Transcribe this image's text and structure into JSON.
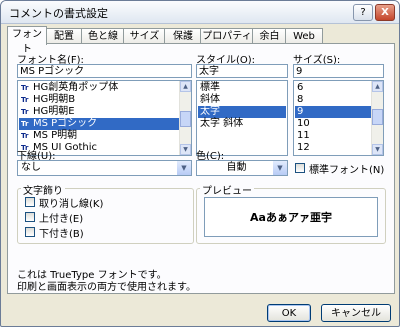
{
  "window": {
    "title": "コメントの書式設定",
    "help": "?",
    "close": "X"
  },
  "tabs": [
    "フォント",
    "配置",
    "色と線",
    "サイズ",
    "保護",
    "プロパティ",
    "余白",
    "Web"
  ],
  "font": {
    "label": "フォント名(F):",
    "value": "MS Pゴシック",
    "items": [
      "HG創英角ポップ体",
      "HG明朝B",
      "HG明朝E",
      "MS Pゴシック",
      "MS P明朝",
      "MS UI Gothic"
    ],
    "selected_index": 3,
    "icon_label": "Tr"
  },
  "style": {
    "label": "スタイル(O):",
    "value": "太字",
    "items": [
      "標準",
      "斜体",
      "太字",
      "太字 斜体"
    ],
    "selected_index": 2
  },
  "size": {
    "label": "サイズ(S):",
    "value": "9",
    "items": [
      "6",
      "8",
      "9",
      "10",
      "11",
      "12"
    ],
    "selected_index": 2
  },
  "underline": {
    "label": "下線(U):",
    "value": "なし"
  },
  "color": {
    "label": "色(C):",
    "value": "自動"
  },
  "normal_font": {
    "label": "標準フォント(N)",
    "checked": false
  },
  "effects": {
    "title": "文字飾り",
    "strikethrough": "取り消し線(K)",
    "superscript": "上付き(E)",
    "subscript": "下付き(B)"
  },
  "preview": {
    "title": "プレビュー",
    "sample": "Aaあぁアァ亜宇"
  },
  "info": {
    "line1": "これは TrueType フォントです。",
    "line2": "印刷と画面表示の両方で使用されます。"
  },
  "buttons": {
    "ok": "OK",
    "cancel": "キャンセル"
  },
  "colors": {
    "selection": "#316ac5",
    "dialog_bg": "#ece9d8",
    "panel_bg": "#fcfcfe"
  }
}
